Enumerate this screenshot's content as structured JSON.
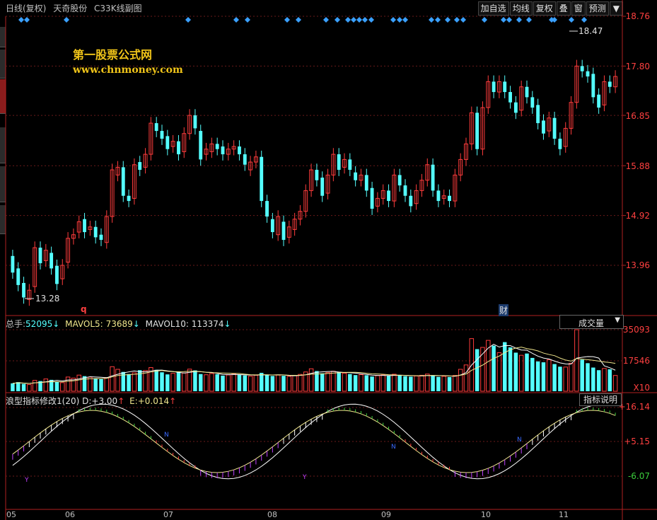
{
  "titlebar": {
    "period": "日线(复权)",
    "stock": "天奇股份",
    "view": "C33K线副图"
  },
  "toolbar": {
    "items": [
      "加自选",
      "均线",
      "复权",
      "叠",
      "窗",
      "预测"
    ],
    "menu_arrow": "▼"
  },
  "watermark": {
    "line1": "第一股票公式网",
    "line2": "www.chnmoney.com"
  },
  "price_axis": {
    "labels": [
      "18.76",
      "17.80",
      "16.85",
      "15.88",
      "14.92",
      "13.96"
    ]
  },
  "annotations": {
    "high": "18.47",
    "low": "13.28",
    "marker_q": "q",
    "marker_cai": "财"
  },
  "volume_panel": {
    "label_total": "总手:",
    "total_value": "52095",
    "ma5_label": "MAVOL5:",
    "ma5_value": "73689",
    "ma10_label": "MAVOL10:",
    "ma10_value": "113374",
    "arrow": "↓",
    "dropdown": "成交量",
    "axis": [
      "35093",
      "17546",
      "X10"
    ]
  },
  "indicator_panel": {
    "title": "浪型指标修改1(20)",
    "d_label": "D:",
    "d_value": "+3.00",
    "e_label": "E:",
    "e_value": "+0.014",
    "up_arrow": "↑",
    "button": "指标说明",
    "axis": [
      "+16.14",
      "+5.15",
      "-6.07"
    ],
    "marks": [
      "Y",
      "N",
      "Y",
      "N",
      "N"
    ]
  },
  "months": [
    "05",
    "06",
    "07",
    "08",
    "09",
    "10",
    "11"
  ],
  "colors": {
    "up": "#ff3c3c",
    "down": "#54ffff",
    "axis_red": "#ff4040",
    "diamond": "#3aa0ff",
    "watermark": "#f0c419"
  },
  "price_series": [
    [
      14.14,
      13.82
    ],
    [
      13.9,
      13.58
    ],
    [
      13.62,
      13.34
    ],
    [
      13.3,
      13.48
    ],
    [
      13.55,
      14.3
    ],
    [
      14.3,
      14.0
    ],
    [
      14.05,
      14.25
    ],
    [
      14.2,
      13.9
    ],
    [
      13.95,
      13.6
    ],
    [
      13.7,
      13.96
    ],
    [
      14.02,
      14.48
    ],
    [
      14.48,
      14.55
    ],
    [
      14.6,
      14.8
    ],
    [
      14.85,
      14.6
    ],
    [
      14.65,
      14.7
    ],
    [
      14.7,
      14.5
    ],
    [
      14.55,
      14.45
    ],
    [
      14.4,
      14.9
    ],
    [
      14.9,
      15.8
    ],
    [
      15.7,
      15.85
    ],
    [
      15.85,
      15.3
    ],
    [
      15.3,
      15.2
    ],
    [
      15.25,
      15.9
    ],
    [
      15.95,
      15.8
    ],
    [
      15.85,
      16.1
    ],
    [
      16.1,
      16.7
    ],
    [
      16.7,
      16.55
    ],
    [
      16.55,
      16.4
    ],
    [
      16.45,
      16.2
    ],
    [
      16.25,
      16.35
    ],
    [
      16.35,
      16.1
    ],
    [
      16.15,
      16.5
    ],
    [
      16.5,
      16.85
    ],
    [
      16.85,
      16.6
    ],
    [
      16.55,
      16.0
    ],
    [
      16.1,
      16.2
    ],
    [
      16.15,
      16.3
    ],
    [
      16.3,
      16.2
    ],
    [
      16.25,
      16.1
    ],
    [
      16.1,
      16.2
    ],
    [
      16.2,
      16.25
    ],
    [
      16.25,
      16.1
    ],
    [
      16.1,
      15.9
    ],
    [
      15.8,
      15.95
    ],
    [
      15.95,
      16.05
    ],
    [
      16.05,
      15.2
    ],
    [
      15.2,
      14.9
    ],
    [
      14.85,
      14.6
    ],
    [
      14.55,
      14.9
    ],
    [
      14.8,
      14.45
    ],
    [
      14.5,
      14.7
    ],
    [
      14.65,
      14.85
    ],
    [
      14.85,
      15.0
    ],
    [
      15.0,
      15.4
    ],
    [
      15.4,
      15.8
    ],
    [
      15.8,
      15.6
    ],
    [
      15.65,
      15.3
    ],
    [
      15.35,
      15.7
    ],
    [
      15.7,
      16.1
    ],
    [
      16.1,
      15.8
    ],
    [
      15.85,
      16.0
    ],
    [
      16.0,
      15.8
    ],
    [
      15.75,
      15.6
    ],
    [
      15.6,
      15.7
    ],
    [
      15.7,
      15.4
    ],
    [
      15.45,
      15.05
    ],
    [
      15.1,
      15.25
    ],
    [
      15.25,
      15.4
    ],
    [
      15.4,
      15.2
    ],
    [
      15.2,
      15.7
    ],
    [
      15.7,
      15.5
    ],
    [
      15.5,
      15.3
    ],
    [
      15.3,
      15.1
    ],
    [
      15.15,
      15.4
    ],
    [
      15.4,
      15.6
    ],
    [
      15.6,
      15.9
    ],
    [
      15.9,
      15.4
    ],
    [
      15.4,
      15.2
    ],
    [
      15.25,
      15.3
    ],
    [
      15.3,
      15.2
    ],
    [
      15.2,
      15.7
    ],
    [
      15.7,
      16.0
    ],
    [
      16.0,
      16.3
    ],
    [
      16.3,
      16.9
    ],
    [
      16.9,
      16.2
    ],
    [
      16.2,
      17.0
    ],
    [
      17.0,
      17.5
    ],
    [
      17.5,
      17.3
    ],
    [
      17.3,
      17.5
    ],
    [
      17.5,
      17.3
    ],
    [
      17.3,
      17.1
    ],
    [
      17.1,
      16.9
    ],
    [
      16.95,
      17.4
    ],
    [
      17.4,
      17.2
    ],
    [
      17.2,
      17.0
    ],
    [
      17.05,
      16.7
    ],
    [
      16.75,
      16.5
    ],
    [
      16.55,
      16.8
    ],
    [
      16.8,
      16.4
    ],
    [
      16.4,
      16.2
    ],
    [
      16.25,
      16.6
    ],
    [
      16.6,
      17.1
    ],
    [
      17.1,
      17.8
    ],
    [
      17.8,
      17.7
    ],
    [
      17.7,
      17.6
    ],
    [
      17.65,
      17.2
    ],
    [
      17.25,
      17.0
    ],
    [
      17.05,
      17.5
    ],
    [
      17.5,
      17.4
    ],
    [
      17.4,
      17.6
    ]
  ],
  "volume_series": [
    4500,
    5200,
    4200,
    3800,
    6200,
    5800,
    7000,
    6500,
    5400,
    4900,
    8100,
    7500,
    9200,
    8600,
    8000,
    7200,
    6900,
    7800,
    14000,
    12500,
    11000,
    9800,
    10500,
    12000,
    11800,
    13500,
    12200,
    10800,
    9600,
    10200,
    11000,
    10400,
    12600,
    11900,
    9800,
    9400,
    10100,
    9700,
    8900,
    9300,
    9900,
    9500,
    9000,
    8600,
    9100,
    10500,
    9400,
    8700,
    9200,
    8800,
    8500,
    9000,
    9600,
    11000,
    12800,
    11500,
    10200,
    10600,
    11400,
    10900,
    10300,
    9800,
    9200,
    9500,
    9100,
    8400,
    8900,
    9300,
    8800,
    9700,
    9000,
    8600,
    8300,
    8700,
    9100,
    9800,
    8900,
    8200,
    8500,
    8100,
    9000,
    12500,
    15000,
    30000,
    24000,
    25000,
    29000,
    26000,
    22000,
    28000,
    25000,
    22000,
    20500,
    21500,
    19000,
    17000,
    16500,
    18000,
    15500,
    14000,
    13800,
    16000,
    35093,
    18000,
    16000,
    13500,
    12000,
    13000,
    12500,
    9000
  ]
}
